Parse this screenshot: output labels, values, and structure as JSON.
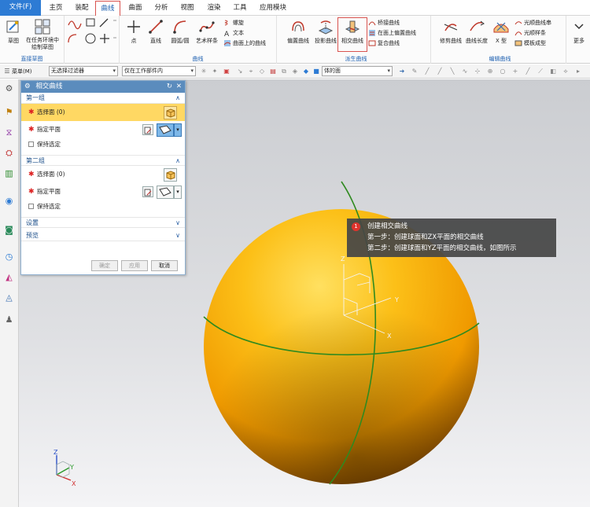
{
  "menu": {
    "file": "文件(F)",
    "tabs": [
      "主页",
      "装配",
      "曲线",
      "曲面",
      "分析",
      "视图",
      "渲染",
      "工具",
      "应用模块"
    ]
  },
  "ribbon": {
    "sketch_group": {
      "label": "直接草图",
      "sketch": "草图",
      "task_sketch": "在任务环境中绘制草图"
    },
    "curve_group": {
      "label": "曲线",
      "point": "点",
      "line": "直线",
      "arc": "圆弧/圆",
      "art_spline": "艺术样条",
      "helix": "螺旋",
      "text": "文本",
      "curve_on_surface": "曲面上的曲线"
    },
    "derived_group": {
      "label": "派生曲线",
      "offset": "偏置曲线",
      "project": "投影曲线",
      "intersect": "相交曲线",
      "bridge": "桥接曲线",
      "offset_in_face": "在面上偏置曲线",
      "composite": "复合曲线"
    },
    "edit_group": {
      "label": "编辑曲线",
      "trim": "修剪曲线",
      "length": "曲线长度",
      "x_form": "X 型",
      "fair_string": "光顺曲线串",
      "fair_spline": "光顺样条",
      "template": "模板成型"
    },
    "more": "更多"
  },
  "toolbar": {
    "menu": "菜单(M)",
    "filter": "无选择过滤器",
    "scope": "仅在工作部件内",
    "face_rule": "体的面"
  },
  "dialog": {
    "title": "相交曲线",
    "group1": {
      "header": "第一组",
      "select_face": "选择面 (0)",
      "specify_plane": "指定平面",
      "keep_selected": "保持选定"
    },
    "group2": {
      "header": "第二组",
      "select_face": "选择面 (0)",
      "specify_plane": "指定平面",
      "keep_selected": "保持选定"
    },
    "settings": "设置",
    "preview": "预览",
    "ok": "确定",
    "apply": "应用",
    "cancel": "取消"
  },
  "tooltip": {
    "number": "1",
    "line1": "创建相交曲线",
    "line2": "第一步：创建球面和ZX平面的相交曲线",
    "line3": "第二步：创建球面和YZ平面的相交曲线，如图所示"
  },
  "axes": {
    "x": "X",
    "y": "Y",
    "z": "Z"
  },
  "colors": {
    "accent": "#2d7bd4",
    "highlight": "#d9534f",
    "selected_row": "#ffd863",
    "sphere": "#f5a800",
    "curve": "#2f8a1f",
    "dialog_title": "#5b8cbd",
    "tooltip_bg": "#464646"
  }
}
